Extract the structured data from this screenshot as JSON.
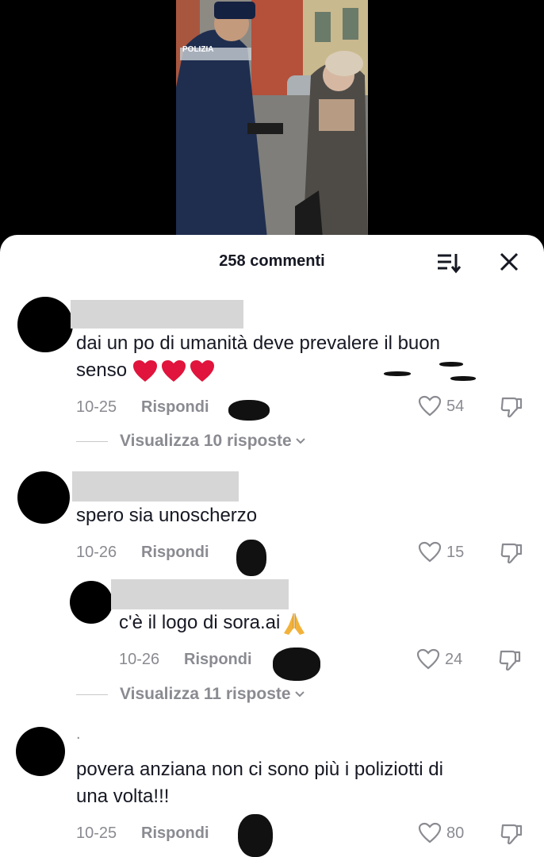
{
  "header": {
    "comment_count": "258 commenti"
  },
  "comments": [
    {
      "text_line1": "dai un po di umanità deve prevalere il buon",
      "text_line2": "senso",
      "date": "10-25",
      "reply_label": "Rispondi",
      "likes": "54",
      "view_replies": "Visualizza 10 risposte"
    },
    {
      "text": "spero sia unoscherzo",
      "date": "10-26",
      "reply_label": "Rispondi",
      "likes": "15"
    },
    {
      "text": "c'è il logo di sora.ai",
      "date": "10-26",
      "reply_label": "Rispondi",
      "likes": "24",
      "view_replies": "Visualizza 11 risposte"
    },
    {
      "username": ".",
      "text_line1": "povera anziana non ci sono più i poliziotti di",
      "text_line2": "una volta!!!",
      "date": "10-25",
      "reply_label": "Rispondi",
      "likes": "80"
    }
  ],
  "video": {
    "badge_text": "POLIZIA"
  },
  "icons": {
    "sort": "sort-icon",
    "close": "close-icon",
    "like": "heart-outline-icon",
    "dislike": "thumbs-down-icon",
    "chevron": "chevron-down-icon",
    "emoji_heart": "red-heart-emoji",
    "emoji_pray": "folded-hands-emoji"
  },
  "colors": {
    "text": "#161823",
    "secondary": "#8a8b91",
    "heart_emoji": "#e0143c",
    "redacted": "#d6d6d6"
  }
}
